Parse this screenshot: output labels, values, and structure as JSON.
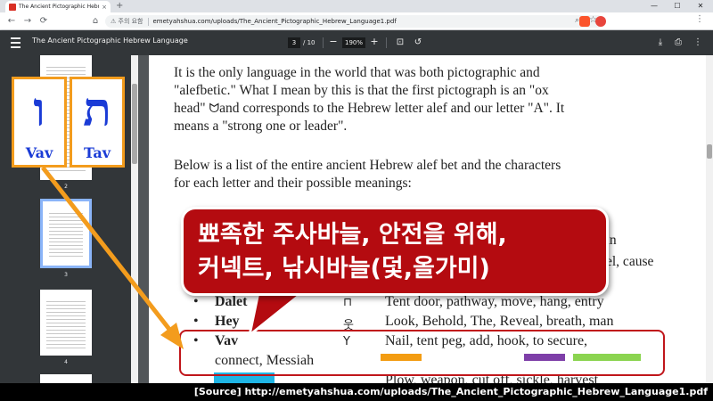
{
  "browser": {
    "tab_title": "The Ancient Pictographic Hebrew La",
    "tab_close": "×",
    "new_tab": "+",
    "window_controls": [
      "—",
      "☐",
      "✕"
    ],
    "nav": {
      "back": "←",
      "forward": "→",
      "reload": "⟳",
      "bookmark": "⌂"
    },
    "security_label": "⚠ 주의 요함",
    "url": "emetyahshua.com/uploads/The_Ancient_Pictographic_Hebrew_Language1.pdf",
    "zoom_icon": "⌕",
    "star_icon": "☆",
    "more_icon": "⋮"
  },
  "pdf_toolbar": {
    "title": "The Ancient Pictographic Hebrew Language",
    "current_page": "3",
    "total_pages": "/ 10",
    "zoom_out": "−",
    "zoom_level": "190%",
    "zoom_in": "+",
    "fit_icon": "⊡",
    "rotate_icon": "↺",
    "download_icon": "⤓",
    "print_icon": "⎙",
    "more_icon": "⋮"
  },
  "sidebar": {
    "thumbnails": [
      {
        "page_number": "2"
      },
      {
        "page_number": "3",
        "selected": true
      },
      {
        "page_number": "4"
      }
    ]
  },
  "cards": [
    {
      "glyph": "ו",
      "label": "Vav"
    },
    {
      "glyph": "ת",
      "label": "Tav"
    }
  ],
  "document": {
    "paragraph1": [
      "It is the only language in the world that was both pictographic and",
      "\"alefbetic.\" What I mean by this is that the first pictograph is an \"ox",
      "head\"",
      "and corresponds to the Hebrew letter alef and our letter \"A\". It",
      "means a \"strong one or leader\"."
    ],
    "ox_glyph": "ᗢ",
    "paragraph2": [
      "Below is a list of the entire ancient Hebrew alef bet and the characters",
      "for each letter and their possible meanings:"
    ],
    "partial_right_1": "an",
    "partial_right_2": "el, cause",
    "letters": [
      {
        "bullet": "•",
        "name": "Dalet",
        "glyph": "⊓",
        "meaning": "Tent door, pathway, move, hang, entry"
      },
      {
        "bullet": "•",
        "name": "Hey",
        "glyph": "웃",
        "meaning": "Look, Behold, The, Reveal, breath, man"
      },
      {
        "bullet": "•",
        "name": "Vav",
        "glyph": "Y",
        "meaning": "Nail, tent peg, add, hook, to secure,"
      }
    ],
    "vav_continuation": "connect, Messiah",
    "next_meaning": "Plow, weapon, cut off, sickle, harvest"
  },
  "callout": {
    "line1": "뾰족한 주사바늘, 안전을 위해,",
    "line2": "커넥트, 낚시바늘(덫,올가미)"
  },
  "colors": {
    "accent_orange": "#f39c1d",
    "callout_red": "#b40b10",
    "highlight_orange": "#f39c12",
    "highlight_purple": "#7e3fa8",
    "highlight_green": "#8bd450",
    "highlight_cyan": "#1fb5e5"
  },
  "caption": "[Source] http://emetyahshua.com/uploads/The_Ancient_Pictographic_Hebrew_Language1.pdf"
}
